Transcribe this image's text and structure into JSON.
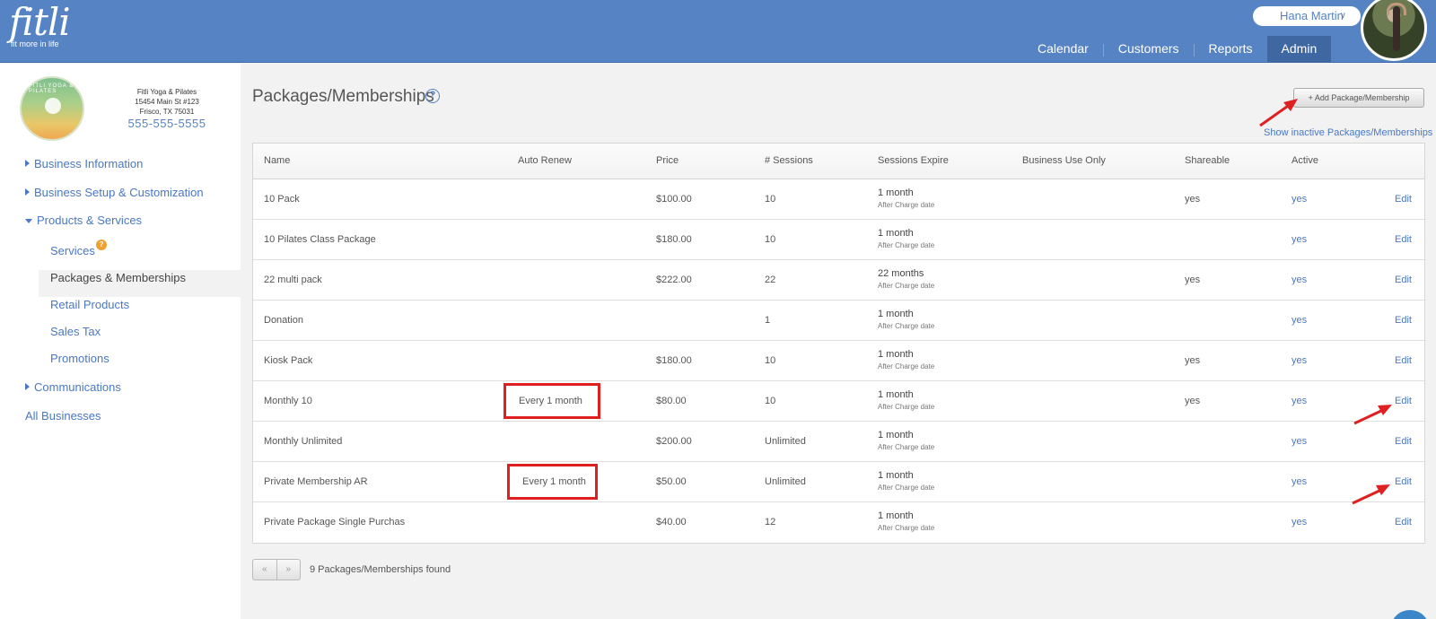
{
  "header": {
    "logo_text": "fitli",
    "logo_tagline": "fit more in life",
    "user_name": "Hana Martin",
    "nav": [
      {
        "label": "Calendar"
      },
      {
        "label": "Customers"
      },
      {
        "label": "Reports"
      },
      {
        "label": "Admin"
      }
    ],
    "brand_color": "#5683c4"
  },
  "business": {
    "logo_text": "FITLI YOGA & PILATES",
    "name": "Fitli Yoga & Pilates",
    "address1": "15454 Main St #123",
    "address2": "Frisco, TX 75031",
    "phone": "555-555-5555"
  },
  "sidebar": {
    "items": [
      {
        "label": "Business Information"
      },
      {
        "label": "Business Setup & Customization"
      },
      {
        "label": "Products & Services"
      },
      {
        "label": "Services"
      },
      {
        "label": "Packages & Memberships"
      },
      {
        "label": "Retail Products"
      },
      {
        "label": "Sales Tax"
      },
      {
        "label": "Promotions"
      },
      {
        "label": "Communications"
      },
      {
        "label": "All Businesses"
      }
    ],
    "services_badge": "?"
  },
  "main": {
    "title": "Packages/Memberships",
    "help_icon": "?",
    "add_button": "+ Add Package/Membership",
    "show_inactive": "Show inactive Packages/Memberships",
    "columns": [
      "Name",
      "Auto Renew",
      "Price",
      "# Sessions",
      "Sessions Expire",
      "Business Use Only",
      "Shareable",
      "Active"
    ],
    "rows": [
      {
        "name": "10 Pack",
        "auto_renew": "",
        "price": "$100.00",
        "sessions": "10",
        "expire": "1 month",
        "expire_note": "After Charge date",
        "business_only": "",
        "shareable": "yes",
        "active": "yes",
        "action": "Edit"
      },
      {
        "name": "10 Pilates Class Package",
        "auto_renew": "",
        "price": "$180.00",
        "sessions": "10",
        "expire": "1 month",
        "expire_note": "After Charge date",
        "business_only": "",
        "shareable": "",
        "active": "yes",
        "action": "Edit"
      },
      {
        "name": "22 multi pack",
        "auto_renew": "",
        "price": "$222.00",
        "sessions": "22",
        "expire": "22 months",
        "expire_note": "After Charge date",
        "business_only": "",
        "shareable": "yes",
        "active": "yes",
        "action": "Edit"
      },
      {
        "name": "Donation",
        "auto_renew": "",
        "price": "",
        "sessions": "1",
        "expire": "1 month",
        "expire_note": "After Charge date",
        "business_only": "",
        "shareable": "",
        "active": "yes",
        "action": "Edit"
      },
      {
        "name": "Kiosk Pack",
        "auto_renew": "",
        "price": "$180.00",
        "sessions": "10",
        "expire": "1 month",
        "expire_note": "After Charge date",
        "business_only": "",
        "shareable": "yes",
        "active": "yes",
        "action": "Edit"
      },
      {
        "name": "Monthly 10",
        "auto_renew": "Every 1 month",
        "price": "$80.00",
        "sessions": "10",
        "expire": "1 month",
        "expire_note": "After Charge date",
        "business_only": "",
        "shareable": "yes",
        "active": "yes",
        "action": "Edit"
      },
      {
        "name": "Monthly Unlimited",
        "auto_renew": "",
        "price": "$200.00",
        "sessions": "Unlimited",
        "expire": "1 month",
        "expire_note": "After Charge date",
        "business_only": "",
        "shareable": "",
        "active": "yes",
        "action": "Edit"
      },
      {
        "name": "Private Membership AR",
        "auto_renew": "Every 1 month",
        "price": "$50.00",
        "sessions": "Unlimited",
        "expire": "1 month",
        "expire_note": "After Charge date",
        "business_only": "",
        "shareable": "",
        "active": "yes",
        "action": "Edit"
      },
      {
        "name": "Private Package Single Purchas",
        "auto_renew": "",
        "price": "$40.00",
        "sessions": "12",
        "expire": "1 month",
        "expire_note": "After Charge date",
        "business_only": "",
        "shareable": "",
        "active": "yes",
        "action": "Edit"
      }
    ],
    "pager_prev": "«",
    "pager_next": "»",
    "found_text": "9 Packages/Memberships found"
  },
  "annotations": {
    "highlight_color": "#e02020"
  }
}
